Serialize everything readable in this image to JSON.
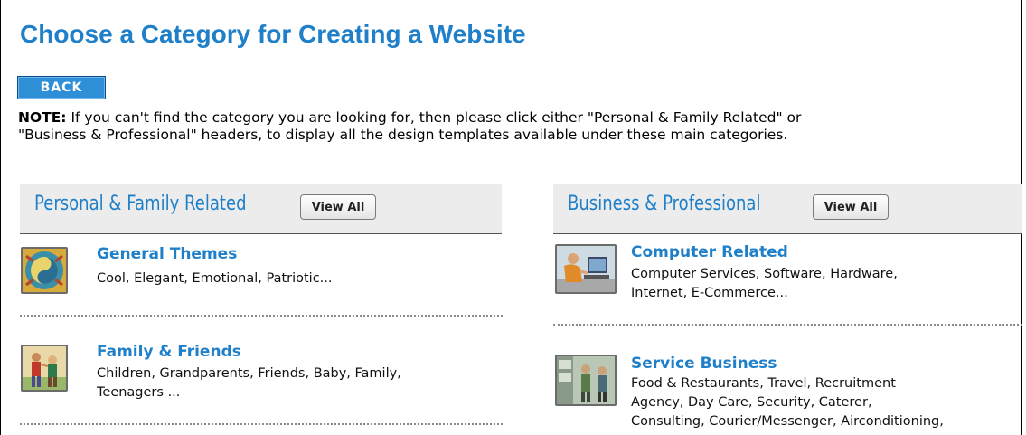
{
  "page": {
    "title": "Choose a Category for Creating a Website",
    "back_label": "BACK",
    "note_label": "NOTE:",
    "note_line1": " If you can't find the category you are looking for, then please click either \"Personal & Family Related\" or",
    "note_line2": "\"Business & Professional\" headers, to display all the design templates available under these main categories."
  },
  "personal": {
    "header": "Personal & Family Related",
    "view_all": "View All",
    "items": [
      {
        "title": "General Themes",
        "desc_lines": [
          "Cool, Elegant, Emotional, Patriotic..."
        ],
        "icon": "general-themes-icon"
      },
      {
        "title": "Family & Friends",
        "desc_lines": [
          "Children, Grandparents, Friends, Baby, Family,",
          "Teenagers ..."
        ],
        "icon": "family-friends-icon"
      }
    ]
  },
  "business": {
    "header": "Business & Professional",
    "view_all": "View All",
    "items": [
      {
        "title": "Computer Related",
        "desc_lines": [
          "Computer Services, Software, Hardware,",
          "Internet, E-Commerce..."
        ],
        "icon": "computer-related-icon"
      },
      {
        "title": "Service Business",
        "desc_lines": [
          "Food & Restaurants, Travel, Recruitment",
          "Agency, Day Care, Security, Caterer,",
          "Consulting, Courier/Messenger, Airconditioning,"
        ],
        "icon": "service-business-icon"
      }
    ]
  },
  "colors": {
    "accent": "#1f80c9",
    "button_bg": "#2f8fd6",
    "header_bg": "#ececec"
  }
}
